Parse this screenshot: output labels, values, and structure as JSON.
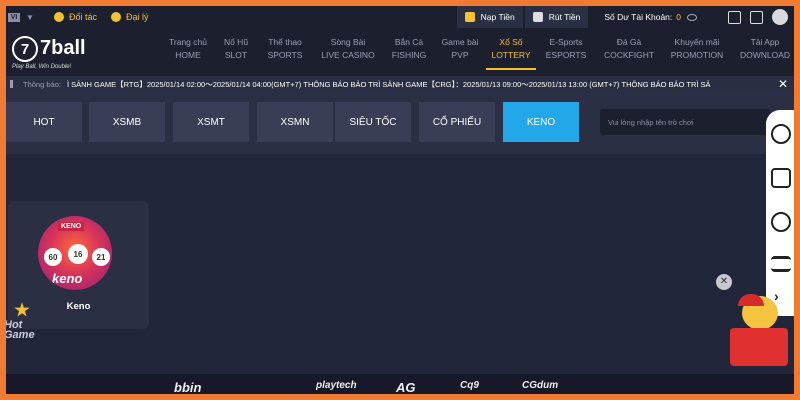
{
  "topbar": {
    "lang": "VI",
    "partner": "Đối tác",
    "agent": "Đại lý",
    "deposit": "Nạp Tiền",
    "withdraw": "Rút Tiền",
    "balance_label": "Số Dư Tài Khoản:",
    "balance_value": "0"
  },
  "brand": {
    "logo_mark": "7",
    "logo_text": "7ball",
    "slogan": "Play Ball, Win Double!"
  },
  "nav": [
    {
      "vi": "Trang chủ",
      "en": "HOME"
    },
    {
      "vi": "Nổ Hũ",
      "en": "SLOT"
    },
    {
      "vi": "Thể thao",
      "en": "SPORTS"
    },
    {
      "vi": "Sòng Bài",
      "en": "LIVE CASINO"
    },
    {
      "vi": "Bắn Cá",
      "en": "FISHING"
    },
    {
      "vi": "Game bài",
      "en": "PVP"
    },
    {
      "vi": "Xổ Số",
      "en": "LOTTERY"
    },
    {
      "vi": "E-Sports",
      "en": "ESPORTS"
    },
    {
      "vi": "Đá Gà",
      "en": "COCKFIGHT"
    },
    {
      "vi": "Khuyến mãi",
      "en": "PROMOTION"
    },
    {
      "vi": "Tải App",
      "en": "DOWNLOAD"
    }
  ],
  "ticker": {
    "label": "Thông báo:",
    "message": "Ì SẢNH GAME【RTG】2025/01/14 02:00～2025/01/14 04:00(GMT+7)      THÔNG BÁO BẢO TRÌ SẢNH GAME【CRG】：2025/01/13 09:00～2025/01/13 13:00 (GMT+7)      THÔNG BÁO BẢO TRÌ SẢ",
    "close": "✕"
  },
  "tabs": [
    "HOT",
    "XSMB",
    "XSMT",
    "XSMN",
    "SIÊU TỐC",
    "CỔ PHIẾU",
    "KENO"
  ],
  "search": {
    "placeholder": "Vui lòng nhập tên trò chơi"
  },
  "game": {
    "name": "Keno",
    "img_title": "KENO",
    "img_logo": "keno",
    "balls": [
      "60",
      "16",
      "21"
    ]
  },
  "grid_logo": {
    "line1": "Hot",
    "line2": "Game"
  },
  "footer_logos": [
    "bbin",
    "playtech",
    "AG",
    "Cq9",
    "CGdum"
  ],
  "float_close": "✕",
  "rail_chevron": "›"
}
